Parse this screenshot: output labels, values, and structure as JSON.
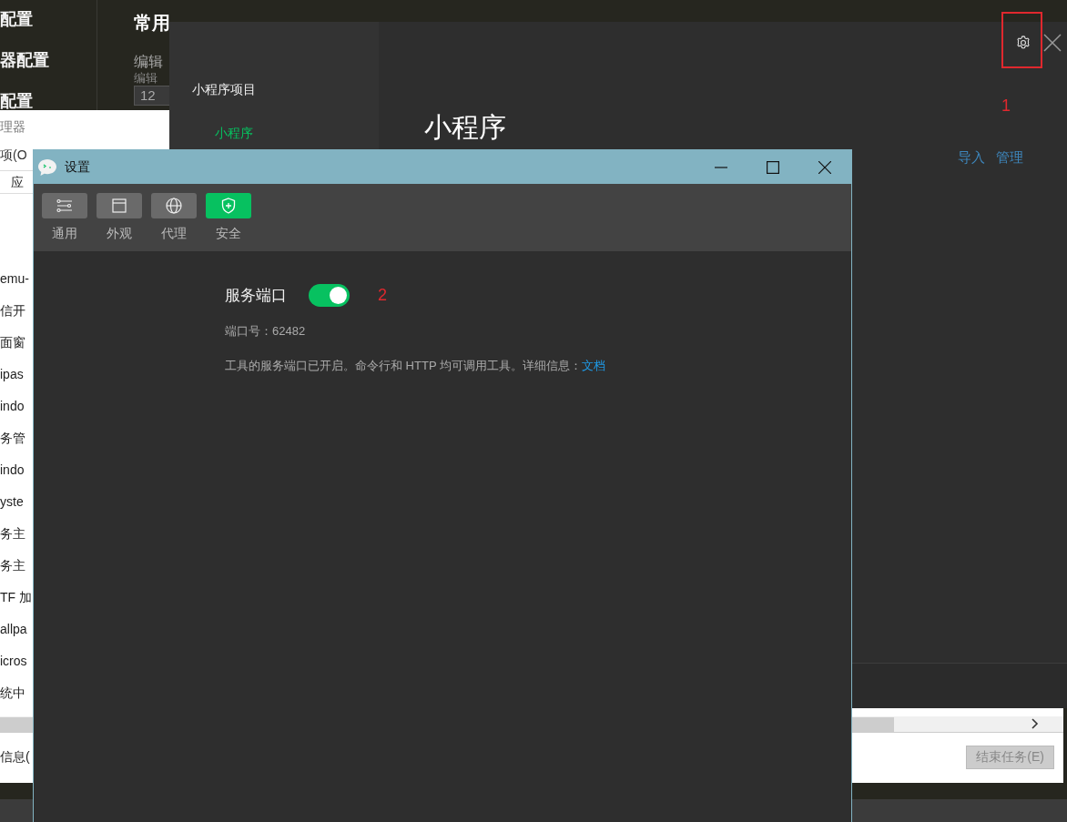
{
  "editor": {
    "sidebar_items": [
      "配置",
      "器配置",
      "配置"
    ],
    "heading": "常用",
    "field_label": "编辑",
    "field_sublabel": "编辑",
    "field_value": "12"
  },
  "task_manager": {
    "title": "理器",
    "menu": "项(O",
    "column_header": "应",
    "processes": [
      "emu-",
      "信开",
      "面窗",
      "ipas",
      "indo",
      "务管",
      "indo",
      "yste",
      "务主",
      "务主",
      "TF 加",
      "allpa",
      "icros",
      "统中"
    ],
    "footer": "信息(",
    "end_task_button": {
      "label": "结束任务(E)",
      "disabled": true
    }
  },
  "devtools_panel": {
    "nav_section": "小程序项目",
    "nav_items": [
      {
        "label": "小程序",
        "selected": true
      }
    ],
    "title": "小程序",
    "annotation": "1",
    "links": [
      "导入",
      "管理"
    ]
  },
  "settings_window": {
    "title": "设置",
    "tabs": [
      {
        "label": "通用",
        "kind": "sliders",
        "selected": false
      },
      {
        "label": "外观",
        "kind": "window",
        "selected": false
      },
      {
        "label": "代理",
        "kind": "globe",
        "selected": false
      },
      {
        "label": "安全",
        "kind": "shield",
        "selected": true
      }
    ],
    "service_port": {
      "label": "服务端口",
      "on": true,
      "annotation": "2"
    },
    "port_line": "端口号：62482",
    "description": "工具的服务端口已开启。命令行和 HTTP 均可调用工具。详细信息：",
    "doc_link": "文档"
  }
}
